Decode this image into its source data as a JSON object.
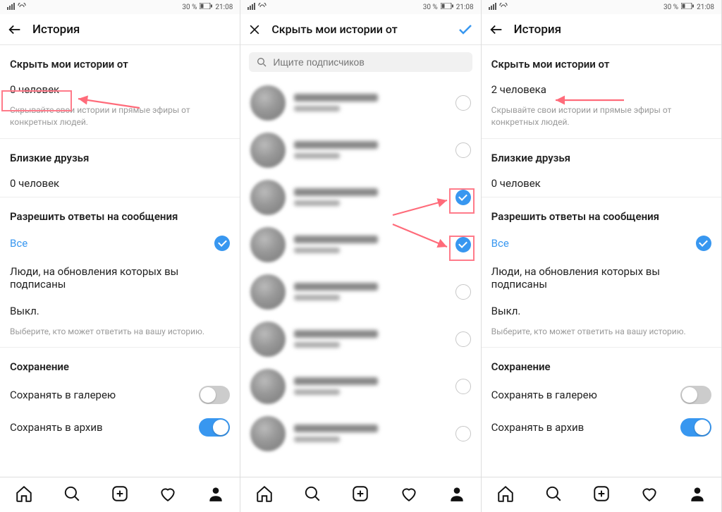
{
  "statusbar": {
    "percent": "30 %",
    "time": "21:08"
  },
  "screens": {
    "a": {
      "title": "История",
      "hide_h": "Скрыть мои истории от",
      "hide_count": "0 человек",
      "hide_cap": "Скрывайте свои истории и прямые эфиры от конкретных людей.",
      "close_h": "Близкие друзья",
      "close_count": "0 человек",
      "reply_h": "Разрешить ответы на сообщения",
      "reply_all": "Все",
      "reply_follow": "Люди, на обновления которых вы подписаны",
      "reply_off": "Выкл.",
      "reply_cap": "Выберите, кто может ответить на вашу историю.",
      "save_h": "Сохранение",
      "save_gallery": "Сохранять в галерею",
      "save_archive": "Сохранять в архив"
    },
    "b": {
      "title": "Скрыть мои истории от",
      "search_ph": "Ищите подписчиков"
    },
    "c": {
      "title": "История",
      "hide_h": "Скрыть мои истории от",
      "hide_count": "2 человека",
      "hide_cap": "Скрывайте свои истории и прямые эфиры от конкретных людей.",
      "close_h": "Близкие друзья",
      "close_count": "0 человек",
      "reply_h": "Разрешить ответы на сообщения",
      "reply_all": "Все",
      "reply_follow": "Люди, на обновления которых вы подписаны",
      "reply_off": "Выкл.",
      "reply_cap": "Выберите, кто может ответить на вашу историю.",
      "save_h": "Сохранение",
      "save_gallery": "Сохранять в галерею",
      "save_archive": "Сохранять в архив"
    }
  }
}
